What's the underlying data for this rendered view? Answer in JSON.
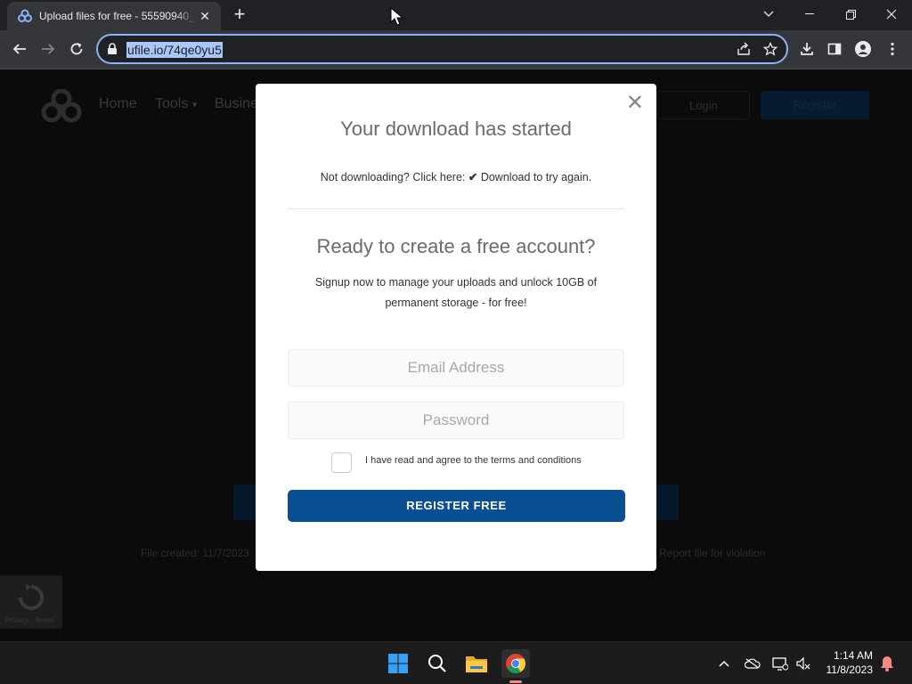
{
  "browser": {
    "tab_title": "Upload files for free - 55590940_",
    "url": "ufile.io/74qe0yu5"
  },
  "site": {
    "nav": {
      "home": "Home",
      "tools": "Tools",
      "business": "Busine"
    },
    "login": "Login",
    "register": "Register",
    "file_created": "File created: 11/7/2023",
    "report": "Report file for violation",
    "recaptcha_text": "Privacy - Terms"
  },
  "modal": {
    "title": "Your download has started",
    "not_downloading": "Not downloading? Click here:",
    "download_link": "Download to try again.",
    "heading2": "Ready to create a free account?",
    "signup_line1": "Signup now to manage your uploads and unlock 10GB of",
    "signup_line2": "permanent storage - for free!",
    "email_placeholder": "Email Address",
    "password_placeholder": "Password",
    "terms": "I have read and agree to the terms and conditions",
    "register_button": "REGISTER FREE"
  },
  "taskbar": {
    "time": "1:14 AM",
    "date": "11/8/2023"
  },
  "colors": {
    "accent": "#0a4f91",
    "omnibox_focus": "#8ab4f8"
  }
}
